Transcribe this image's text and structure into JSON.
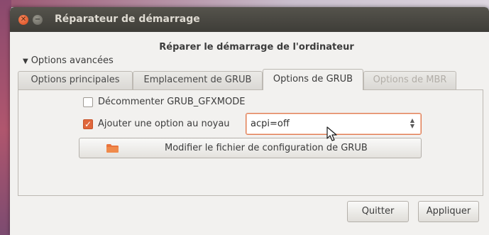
{
  "window": {
    "title": "Réparateur de démarrage",
    "close_glyph": "✕",
    "minimize_glyph": "−"
  },
  "header": {
    "title": "Réparer le démarrage de l'ordinateur"
  },
  "expander": {
    "label": "Options avancées",
    "arrow": "▼"
  },
  "tabs": [
    {
      "label": "Options principales",
      "state": "normal"
    },
    {
      "label": "Emplacement de GRUB",
      "state": "normal"
    },
    {
      "label": "Options de GRUB",
      "state": "active"
    },
    {
      "label": "Options de MBR",
      "state": "disabled"
    }
  ],
  "options": {
    "gfxmode": {
      "label": "Décommenter GRUB_GFXMODE",
      "checked": false
    },
    "kernel_option": {
      "label": "Ajouter une option au noyau",
      "checked": true,
      "check_glyph": "✓"
    },
    "kernel_option_value": "acpi=off",
    "edit_config_label": "Modifier le fichier de configuration de GRUB"
  },
  "buttons": {
    "quit": "Quitter",
    "apply": "Appliquer"
  },
  "icons": [
    "close-icon",
    "minimize-icon",
    "expander-arrow-icon",
    "checkbox-icon",
    "folder-icon",
    "combo-arrows-icon",
    "mouse-cursor-icon"
  ],
  "colors": {
    "accent": "#e0673c",
    "titlebar": "#3e3d38",
    "window_bg": "#f2f1ef"
  }
}
